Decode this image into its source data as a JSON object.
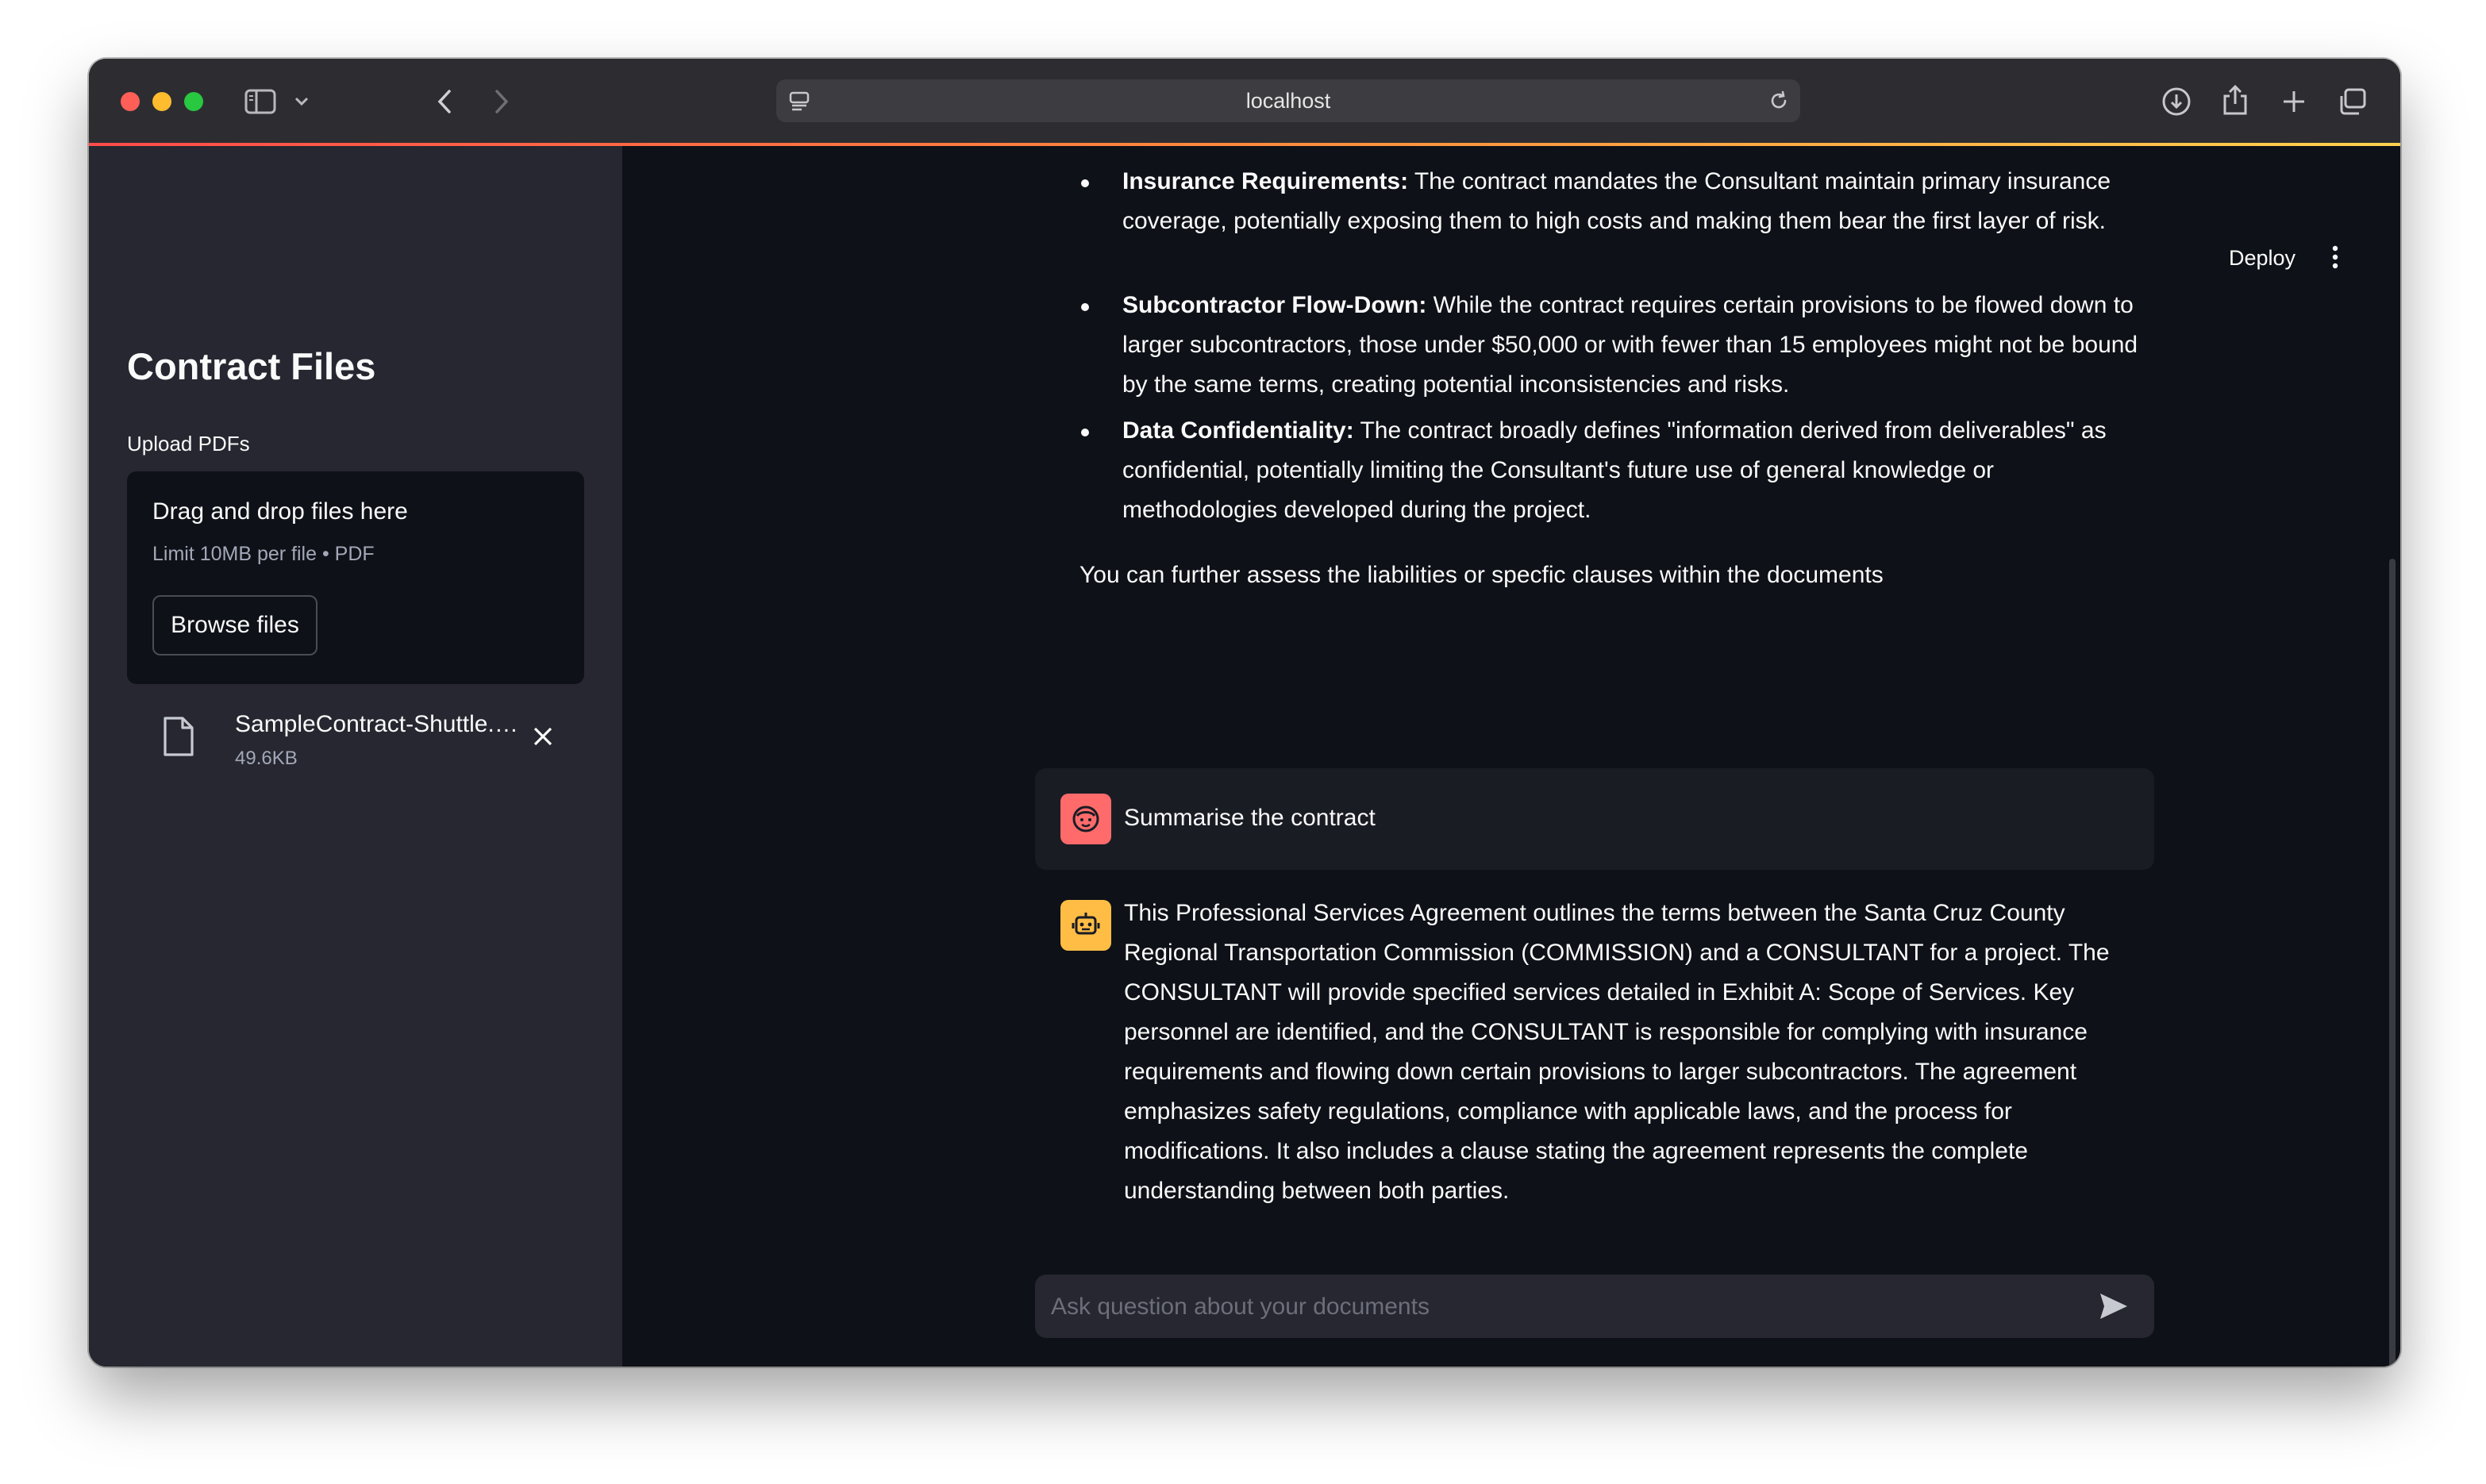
{
  "browser": {
    "url": "localhost",
    "traffic_lights": {
      "close": "#ff5f57",
      "minimize": "#febc2e",
      "zoom": "#28c840"
    }
  },
  "app_header": {
    "deploy_label": "Deploy"
  },
  "sidebar": {
    "title": "Contract Files",
    "upload_label": "Upload PDFs",
    "dropzone": {
      "title": "Drag and drop files here",
      "subtitle": "Limit 10MB per file • PDF",
      "browse_label": "Browse files"
    },
    "files": [
      {
        "name": "SampleContract-Shuttle.…",
        "size": "49.6KB"
      }
    ]
  },
  "chat": {
    "bullets": [
      {
        "bold": "Insurance Requirements:",
        "text": " The contract mandates the Consultant maintain primary insurance coverage, potentially exposing them to high costs and making them bear the first layer of risk."
      },
      {
        "bold": "Subcontractor Flow-Down:",
        "text": " While the contract requires certain provisions to be flowed down to larger subcontractors, those under $50,000 or with fewer than 15 employees might not be bound by the same terms, creating potential inconsistencies and risks."
      },
      {
        "bold": "Data Confidentiality:",
        "text": " The contract broadly defines \"information derived from deliverables\" as confidential, potentially limiting the Consultant's future use of general knowledge or methodologies developed during the project."
      }
    ],
    "followup": "You can further assess the liabilities or specfic clauses within the documents",
    "user_message": "Summarise the contract",
    "assistant_message": "This Professional Services Agreement outlines the terms between the Santa Cruz County Regional Transportation Commission (COMMISSION) and a CONSULTANT for a project. The CONSULTANT will provide specified services detailed in Exhibit A: Scope of Services. Key personnel are identified, and the CONSULTANT is responsible for complying with insurance requirements and flowing down certain provisions to larger subcontractors. The agreement emphasizes safety regulations, compliance with applicable laws, and the process for modifications. It also includes a clause stating the agreement represents the complete understanding between both parties.",
    "input_placeholder": "Ask question about your documents",
    "user_avatar_color": "#ff6b6b",
    "assistant_avatar_color": "#ffbd45"
  }
}
